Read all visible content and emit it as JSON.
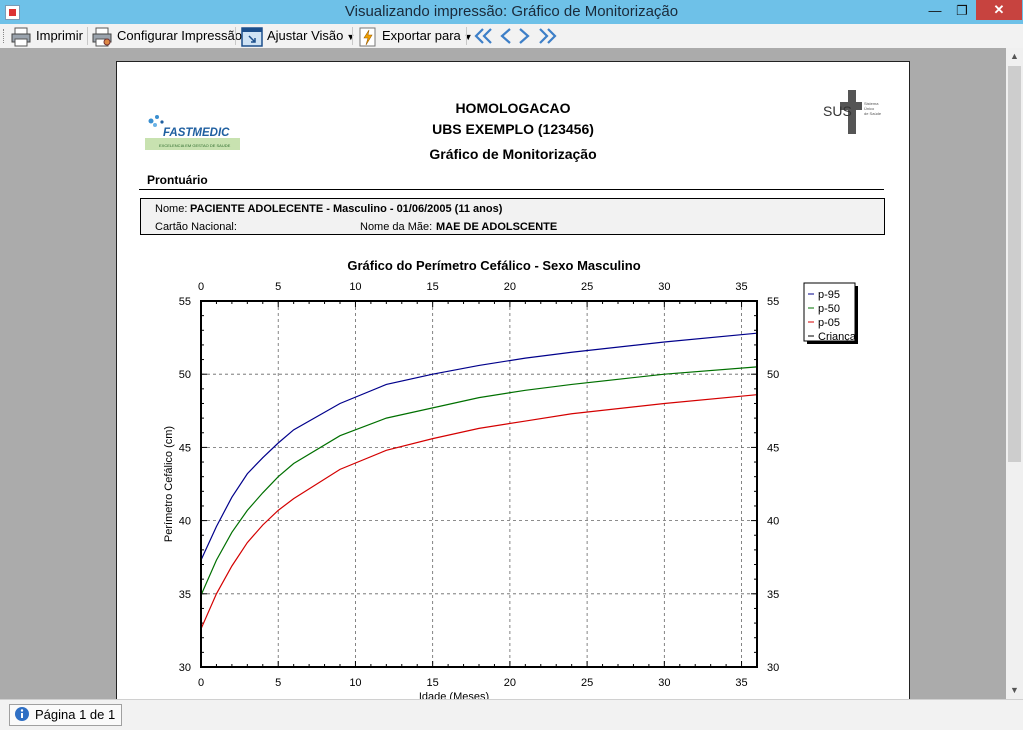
{
  "window": {
    "title": "Visualizando impressão: Gráfico de Monitorização"
  },
  "toolbar": {
    "print": "Imprimir",
    "page_setup": "Configurar Impressão",
    "adjust_view": "Ajustar Visão",
    "export": "Exportar para"
  },
  "report": {
    "line1": "HOMOLOGACAO",
    "line2": "UBS EXEMPLO (123456)",
    "line3": "Gráfico de Monitorização",
    "section": "Prontuário",
    "name_label": "Nome:",
    "name_value": "PACIENTE ADOLECENTE - Masculino - 01/06/2005 (11 anos)",
    "card_label": "Cartão Nacional:",
    "mother_label": "Nome da Mãe:",
    "mother_value": "MAE DE ADOLSCENTE"
  },
  "logos": {
    "fastmedic": "FASTMEDIC",
    "fastmedic_tagline": "EXCELENCIA EM GESTAO DE SAUDE",
    "sus": "SUS",
    "sus_tagline": [
      "Sistema",
      "Único",
      "de Saúde"
    ]
  },
  "status": {
    "page_label": "Página 1 de 1"
  },
  "chart_data": {
    "type": "line",
    "title": "Gráfico do Perímetro Cefálico - Sexo Masculino",
    "xlabel": "Idade (Meses)",
    "ylabel": "Perímetro Cefálico (cm)",
    "xlim": [
      0,
      36
    ],
    "ylim": [
      30,
      55
    ],
    "xticks": [
      0,
      5,
      10,
      15,
      20,
      25,
      30,
      35
    ],
    "yticks": [
      30,
      35,
      40,
      45,
      50,
      55
    ],
    "grid": true,
    "legend_position": "top-right, outside plot",
    "x": [
      0,
      1,
      2,
      3,
      4,
      5,
      6,
      9,
      12,
      15,
      18,
      21,
      24,
      30,
      36
    ],
    "series": [
      {
        "name": "p-95",
        "color": "#00008b",
        "values": [
          37.3,
          39.6,
          41.6,
          43.2,
          44.3,
          45.3,
          46.2,
          48.0,
          49.3,
          50.0,
          50.6,
          51.1,
          51.5,
          52.2,
          52.8
        ]
      },
      {
        "name": "p-50",
        "color": "#007000",
        "values": [
          34.9,
          37.3,
          39.2,
          40.7,
          41.9,
          43.0,
          43.9,
          45.8,
          47.0,
          47.7,
          48.4,
          48.9,
          49.3,
          50.0,
          50.5
        ]
      },
      {
        "name": "p-05",
        "color": "#d40000",
        "values": [
          32.6,
          35.0,
          36.9,
          38.5,
          39.7,
          40.7,
          41.5,
          43.5,
          44.8,
          45.6,
          46.3,
          46.8,
          47.3,
          48.0,
          48.6
        ]
      },
      {
        "name": "Criança",
        "color": "#000000",
        "values": []
      }
    ]
  },
  "colors": {
    "titlebar": "#6ec1e8",
    "close": "#c7433f",
    "workspace": "#ababab"
  }
}
